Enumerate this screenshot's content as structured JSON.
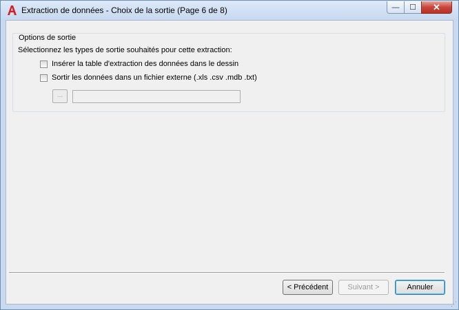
{
  "window": {
    "title": "Extraction de données - Choix de la sortie (Page 6 de 8)",
    "icon": "autocad-a-icon",
    "controls": {
      "minimize": "—",
      "maximize": "☐",
      "close": "✕"
    }
  },
  "output_options": {
    "legend": "Options de sortie",
    "instruction": "Sélectionnez les types de sortie souhaités pour cette extraction:",
    "options": [
      {
        "label": "Insérer la table d'extraction des données dans le dessin",
        "checked": false
      },
      {
        "label": "Sortir les données dans un fichier externe (.xls .csv .mdb .txt)",
        "checked": false
      }
    ],
    "browse_label": "...",
    "file_path": ""
  },
  "buttons": {
    "previous": "< Précédent",
    "next": "Suivant >",
    "cancel": "Annuler"
  }
}
